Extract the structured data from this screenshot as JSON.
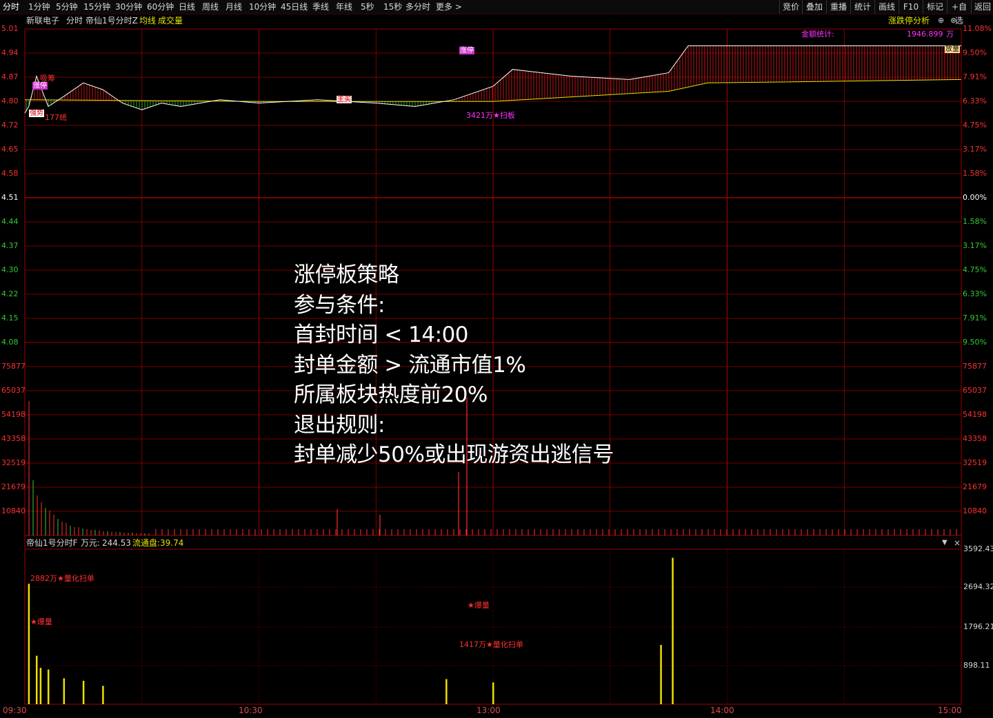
{
  "toolbar": {
    "periods": [
      "分时",
      "1分钟",
      "5分钟",
      "15分钟",
      "30分钟",
      "60分钟",
      "日线",
      "周线",
      "月线",
      "10分钟",
      "45日线",
      "季线",
      "年线",
      "5秒",
      "15秒",
      "多分时",
      "更多 >"
    ],
    "right_buttons": [
      "竞价",
      "叠加",
      "重播",
      "统计",
      "画线",
      "F10",
      "标记",
      "+自选",
      "返回"
    ]
  },
  "header": {
    "stock_name": "新联电子",
    "mode": "分时",
    "indicator": "帝仙1号分时Z",
    "avg_line": "均线",
    "volume": "成交量",
    "analysis_button": "涨跌停分析"
  },
  "amount_stats": {
    "label": "金额统计:",
    "value": "1946.899",
    "unit": "万"
  },
  "price_axis": {
    "left": [
      "5.01",
      "4.94",
      "4.87",
      "4.80",
      "4.72",
      "4.65",
      "4.58",
      "4.51",
      "4.44",
      "4.37",
      "4.30",
      "4.22",
      "4.15",
      "4.08"
    ],
    "right": [
      "11.08%",
      "9.50%",
      "7.91%",
      "6.33%",
      "4.75%",
      "3.17%",
      "1.58%",
      "0.00%",
      "1.58%",
      "3.17%",
      "4.75%",
      "6.33%",
      "7.91%",
      "9.50%"
    ],
    "prev_close": "4.51"
  },
  "volume_axis": {
    "labels": [
      "75877",
      "65037",
      "54198",
      "43358",
      "32519",
      "21679",
      "10840"
    ]
  },
  "sub_panel": {
    "indicator": "帝仙1号分时F",
    "unit_label": "万元:",
    "unit_value": "244.53",
    "float_label": "流通盘:",
    "float_value": "39.74",
    "axis": [
      "3592.43",
      "2694.32",
      "1796.21",
      "898.11"
    ]
  },
  "time_axis": [
    "09:30",
    "10:30",
    "13:00",
    "14:00",
    "15:00"
  ],
  "annotations": {
    "sweep_board": "3421万★扫板",
    "quant_sweep_1": "2882万★量化扫单",
    "burst_volume_1": "★爆量",
    "burst_volume_2": "★爆量",
    "quant_sweep_2": "1417万★量化扫单",
    "tag_177": "177统",
    "tag_zhuli": "主买",
    "tag_fangliang": "放量",
    "tag_qiangshi": "强势",
    "tag_zhangting": "涨停",
    "tag_zhuli2": "涨停",
    "tag_xichou": "吸筹"
  },
  "overlay_text": {
    "title": " 涨停板策略",
    "conditions_label": "参与条件:",
    "cond1": "首封时间 < 14:00",
    "cond2": "封单金额 > 流通市值1%",
    "cond3": "所属板块热度前20%",
    "exit_label": "退出规则:",
    "exit1": "封单减少50%或出现游资出逃信号"
  },
  "colors": {
    "background": "#000000",
    "grid": "#a00000",
    "up": "#ff3030",
    "down": "#33cc33",
    "price_line": "#ffffff",
    "avg_line": "#e6e600",
    "magenta": "#ff33ff"
  },
  "chart_data": {
    "type": "line",
    "title": "新联电子 分时",
    "price_range": [
      4.08,
      5.01
    ],
    "prev_close": 4.51,
    "limit_up_price": 4.96,
    "price_series": [
      {
        "t": "09:30",
        "p": 4.76
      },
      {
        "t": "09:31",
        "p": 4.78
      },
      {
        "t": "09:33",
        "p": 4.87
      },
      {
        "t": "09:36",
        "p": 4.78
      },
      {
        "t": "09:40",
        "p": 4.81
      },
      {
        "t": "09:45",
        "p": 4.85
      },
      {
        "t": "09:50",
        "p": 4.83
      },
      {
        "t": "09:55",
        "p": 4.79
      },
      {
        "t": "10:00",
        "p": 4.77
      },
      {
        "t": "10:05",
        "p": 4.79
      },
      {
        "t": "10:10",
        "p": 4.78
      },
      {
        "t": "10:20",
        "p": 4.8
      },
      {
        "t": "10:30",
        "p": 4.79
      },
      {
        "t": "10:45",
        "p": 4.8
      },
      {
        "t": "11:00",
        "p": 4.79
      },
      {
        "t": "11:10",
        "p": 4.78
      },
      {
        "t": "11:20",
        "p": 4.8
      },
      {
        "t": "11:30",
        "p": 4.84
      },
      {
        "t": "13:05",
        "p": 4.89
      },
      {
        "t": "13:20",
        "p": 4.87
      },
      {
        "t": "13:35",
        "p": 4.86
      },
      {
        "t": "13:45",
        "p": 4.88
      },
      {
        "t": "13:50",
        "p": 4.96
      },
      {
        "t": "15:00",
        "p": 4.96
      }
    ],
    "avg_series": [
      {
        "t": "09:30",
        "p": 4.8
      },
      {
        "t": "10:30",
        "p": 4.795
      },
      {
        "t": "11:30",
        "p": 4.795
      },
      {
        "t": "13:45",
        "p": 4.825
      },
      {
        "t": "13:55",
        "p": 4.85
      },
      {
        "t": "14:30",
        "p": 4.855
      },
      {
        "t": "15:00",
        "p": 4.86
      }
    ],
    "sub_bars": [
      {
        "t": "09:31",
        "v": 2882
      },
      {
        "t": "09:33",
        "v": 1160
      },
      {
        "t": "09:34",
        "v": 870
      },
      {
        "t": "09:36",
        "v": 830
      },
      {
        "t": "09:40",
        "v": 620
      },
      {
        "t": "09:45",
        "v": 560
      },
      {
        "t": "09:50",
        "v": 440
      },
      {
        "t": "11:18",
        "v": 600
      },
      {
        "t": "11:30",
        "v": 520
      },
      {
        "t": "13:43",
        "v": 1417
      },
      {
        "t": "13:46",
        "v": 3502
      }
    ]
  }
}
